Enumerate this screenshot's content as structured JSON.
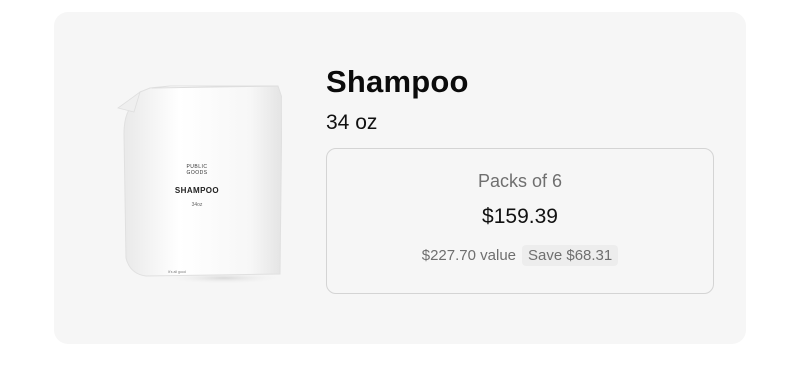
{
  "product": {
    "title": "Shampoo",
    "size": "34 oz",
    "image": {
      "icon": "shampoo-pouch-image",
      "brand_line1": "PUBLIC",
      "brand_line2": "GOODS",
      "label": "SHAMPOO",
      "size": "34oz",
      "tagline": "It's all good"
    }
  },
  "offer": {
    "pack_label": "Packs of 6",
    "price": "$159.39",
    "value": "$227.70 value",
    "savings": "Save $68.31"
  },
  "colors": {
    "card_background": "#f6f6f6",
    "border": "#d4d4d4",
    "muted_text": "#6f6f6f"
  }
}
